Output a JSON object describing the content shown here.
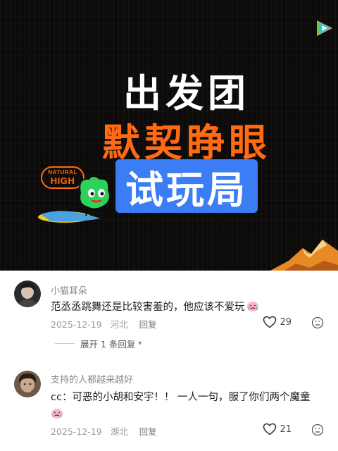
{
  "video": {
    "title_line1": "出发团",
    "title_line2": "默契睁眼",
    "title_line3": "试玩局",
    "logo_top": "NATURAL",
    "logo_bottom": "HIGH",
    "colors": {
      "background": "#0d0b0a",
      "orange": "#ff6a13",
      "blue": "#3b7df4"
    }
  },
  "comments": [
    {
      "username": "小猫耳朵",
      "text": "范丞丞跳舞还是比较害羞的，他应该不爱玩",
      "emoji": "crying-face",
      "date": "2025-12-19",
      "location": "河北",
      "reply_label": "回复",
      "likes": "29"
    },
    {
      "username": "支持的人都越来越好",
      "text_line1": "cc：可恶的小胡和安宇！！ 一人一句，服了你们两个魔童",
      "emoji": "crying-face",
      "date": "2025-12-19",
      "location": "湖北",
      "reply_label": "回复",
      "likes": "21"
    }
  ],
  "expand_replies": "展开 1 条回复"
}
